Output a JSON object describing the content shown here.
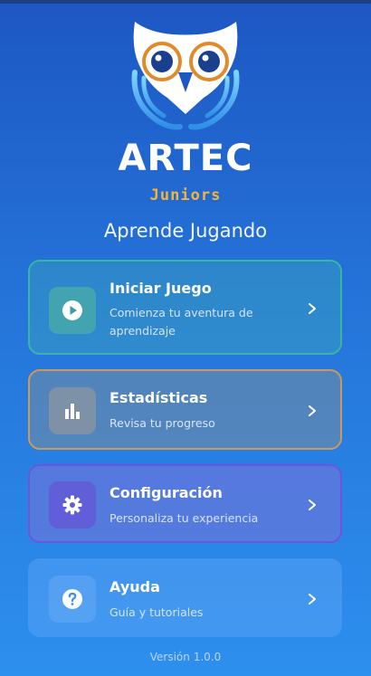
{
  "app": {
    "brand": "ARTEC",
    "subbrand": "Juniors",
    "tagline": "Aprende Jugando",
    "version": "Versión 1.0.0"
  },
  "menu": [
    {
      "title": "Iniciar Juego",
      "subtitle": "Comienza tu aventura de aprendizaje",
      "icon": "play-icon"
    },
    {
      "title": "Estadísticas",
      "subtitle": "Revisa tu progreso",
      "icon": "bar-chart-icon"
    },
    {
      "title": "Configuración",
      "subtitle": "Personaliza tu experiencia",
      "icon": "gear-icon"
    },
    {
      "title": "Ayuda",
      "subtitle": "Guía y tutoriales",
      "icon": "help-icon"
    }
  ],
  "colors": {
    "background_top": "#1d57c4",
    "background_bottom": "#2d8fee",
    "accent_juniors": "#f3b43a",
    "owl_eye": "#e08a2a"
  }
}
